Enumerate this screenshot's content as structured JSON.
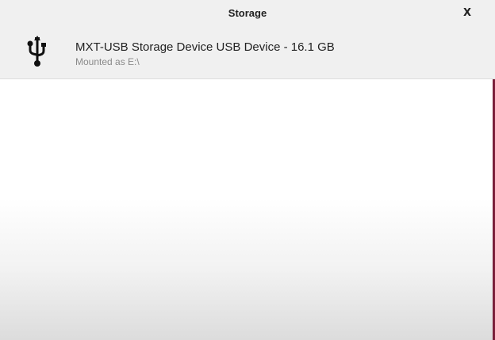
{
  "dialog": {
    "title": "Storage",
    "close_label": "X"
  },
  "devices": [
    {
      "icon": "usb-icon",
      "name": "MXT-USB Storage Device USB Device - 16.1 GB",
      "status": "Mounted as E:\\"
    }
  ],
  "colors": {
    "header_bg": "#f0f0f0",
    "accent_edge": "#7a1f3a",
    "primary_text": "#222222",
    "secondary_text": "#8a8a8a"
  }
}
